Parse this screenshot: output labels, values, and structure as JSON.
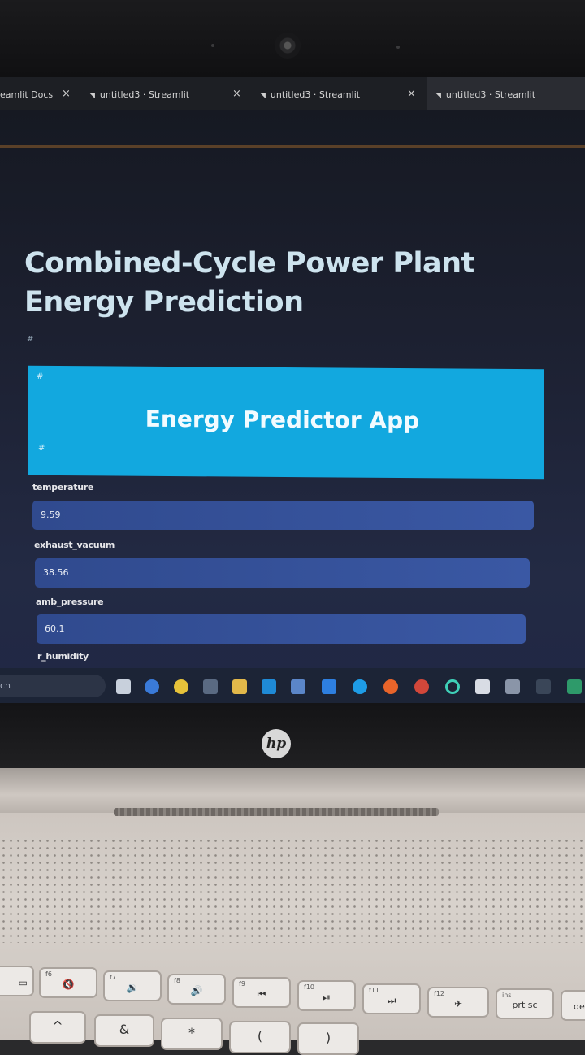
{
  "browser": {
    "tabs": [
      {
        "label": "eamlit Docs"
      },
      {
        "label": "untitled3 · Streamlit"
      },
      {
        "label": "untitled3 · Streamlit"
      },
      {
        "label": "untitled3 · Streamlit"
      }
    ],
    "close_glyph": "×"
  },
  "app": {
    "title_line1": "Combined-Cycle Power Plant",
    "title_line2": "Energy Prediction",
    "hash": "#",
    "banner_title": "Energy Predictor App",
    "fields": [
      {
        "label": "temperature",
        "value": "9.59"
      },
      {
        "label": "exhaust_vacuum",
        "value": "38.56"
      },
      {
        "label": "amb_pressure",
        "value": "60.1"
      },
      {
        "label": "r_humidity",
        "value": ""
      }
    ]
  },
  "taskbar": {
    "search_text": "ch"
  },
  "laptop": {
    "brand": "hp"
  },
  "keyboard": {
    "keys": [
      {
        "fn": "f6",
        "sym": "🔇"
      },
      {
        "fn": "f7",
        "sym": "🔉"
      },
      {
        "fn": "f8",
        "sym": "🔊"
      },
      {
        "fn": "f9",
        "sym": "⏮"
      },
      {
        "fn": "f10",
        "sym": "⏯"
      },
      {
        "fn": "f11",
        "sym": "⏭"
      },
      {
        "fn": "f12",
        "sym": "✈"
      },
      {
        "fn": "ins",
        "sym": "prt sc"
      }
    ],
    "row2": [
      "^",
      "&",
      "*",
      "(",
      ")"
    ],
    "edge_key": "de"
  },
  "colors": {
    "banner": "#12a8df",
    "input": "#3a58a4",
    "title": "#cde3ee"
  }
}
